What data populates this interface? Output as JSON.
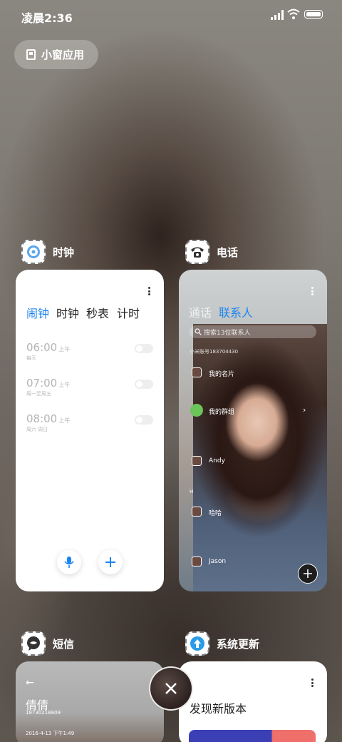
{
  "status_bar": {
    "time": "凌晨2:36"
  },
  "floating_button": {
    "label": "小窗应用"
  },
  "apps": {
    "clock": {
      "title": "时钟",
      "tabs": [
        "闹钟",
        "时钟",
        "秒表",
        "计时"
      ],
      "active_tab": 0,
      "alarms": [
        {
          "time": "06:00",
          "ampm": "上午",
          "repeat": "每天",
          "enabled": false
        },
        {
          "time": "07:00",
          "ampm": "上午",
          "repeat": "周一至周五",
          "enabled": false
        },
        {
          "time": "08:00",
          "ampm": "上午",
          "repeat": "周六 周日",
          "enabled": false
        }
      ]
    },
    "phone": {
      "title": "电话",
      "tabs": [
        "通话",
        "联系人"
      ],
      "active_tab": 1,
      "search_placeholder": "搜索13位联系人",
      "account_line": "小米账号183704430",
      "contacts": [
        {
          "name": "我的名片"
        },
        {
          "name": "我的群组"
        },
        {
          "name": "Andy"
        },
        {
          "section": "H"
        },
        {
          "name": "哈哈"
        },
        {
          "name": "Jason"
        }
      ]
    },
    "sms": {
      "title": "短信",
      "contact_name": "倩倩",
      "contact_number": "18730218809",
      "date_line": "2016-4-13 下午1:49"
    },
    "system_update": {
      "title": "系统更新",
      "headline": "发现新版本"
    }
  },
  "colors": {
    "accent": "#1b85f2",
    "bg": "#7a756e"
  }
}
